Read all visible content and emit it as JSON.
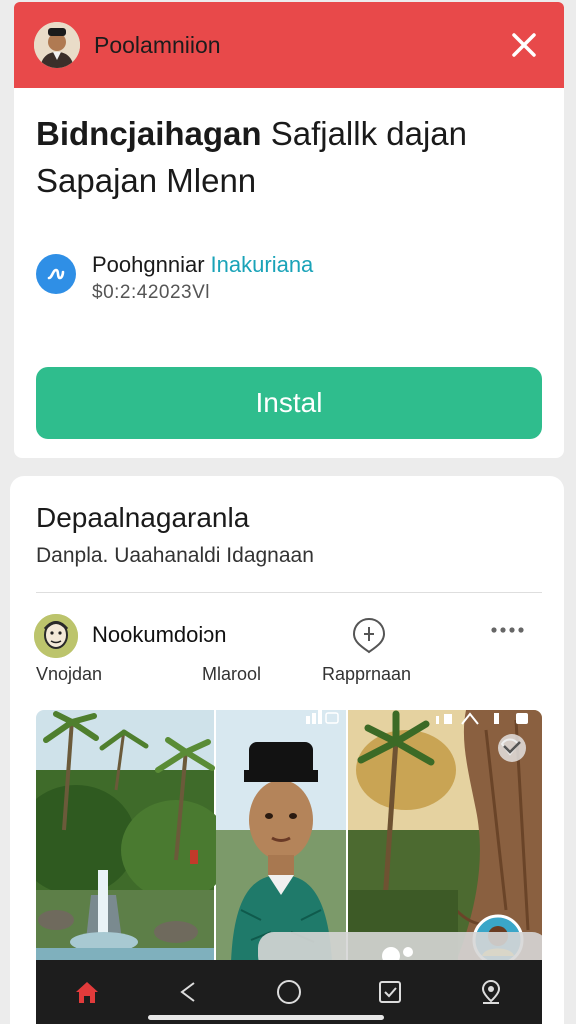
{
  "notification": {
    "title": "Poolamniion",
    "avatar_icon": "person-avatar-icon",
    "close_icon": "close-icon",
    "color": "#e8494a"
  },
  "ad": {
    "headline_bold": "Bidncjaihagan",
    "headline_rest": " Safjallk dajan",
    "headline_line2": "Sapajan Mlenn",
    "publisher_name": "Poohgnniar",
    "publisher_link": "Inakuriana",
    "price": "$0:2:42023Vl",
    "install_label": "Instal",
    "install_color": "#2fbd8d"
  },
  "post": {
    "title": "Depaalnagaranla",
    "subtitle": "Danpla. Uaahanaldi Idagnaan",
    "author": "Nookumdoiɔn",
    "meta": [
      "Vnojdan",
      "Mlarool",
      "Rapprnaan"
    ],
    "share_icon": "share-icon",
    "more_icon": "more-horizontal-icon"
  },
  "gallery": {
    "status_icons": [
      "signal-icon",
      "wifi-icon",
      "battery-icon"
    ]
  },
  "navbar": {
    "items": [
      "home-icon",
      "back-icon",
      "circle-icon",
      "checkbox-icon",
      "location-pin-icon"
    ],
    "active_color": "#e23b3b"
  }
}
